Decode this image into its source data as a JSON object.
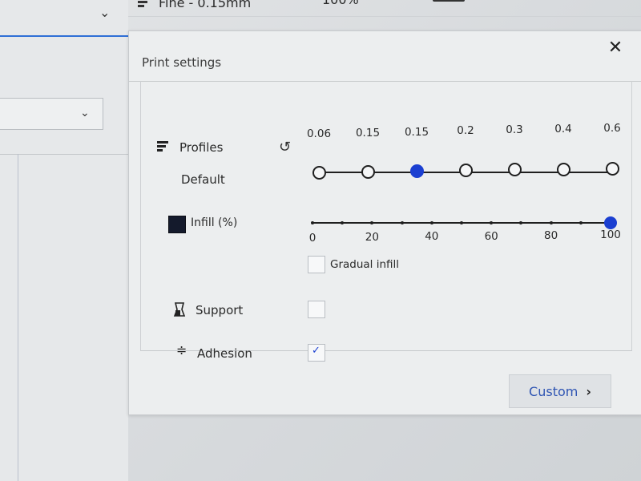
{
  "toolbar": {
    "quality_label": "Fine - 0.15mm",
    "infill_label": "100%"
  },
  "panel": {
    "title": "Print settings",
    "close_label": "✕"
  },
  "profiles": {
    "label": "Profiles",
    "sublabel": "Default",
    "values": [
      "0.06",
      "0.15",
      "0.15",
      "0.2",
      "0.3",
      "0.4",
      "0.6"
    ],
    "selected_index": 2
  },
  "infill": {
    "label": "Infill (%)",
    "ticks": [
      "0",
      "20",
      "40",
      "60",
      "80",
      "100"
    ],
    "value_percent": 100,
    "gradual_label": "Gradual infill",
    "gradual_checked": false
  },
  "support": {
    "label": "Support",
    "checked": false
  },
  "adhesion": {
    "label": "Adhesion",
    "checked": true
  },
  "footer": {
    "custom_label": "Custom",
    "custom_chevron": "›"
  },
  "colors": {
    "accent": "#1b3fd1",
    "link": "#2f55b3",
    "panel_bg": "#eceeef"
  },
  "icons": {
    "quality": "layer-bars-icon",
    "reset": "reset-icon",
    "infill": "infill-square-icon",
    "support": "support-icon",
    "adhesion": "adhesion-icon",
    "close": "close-icon"
  }
}
